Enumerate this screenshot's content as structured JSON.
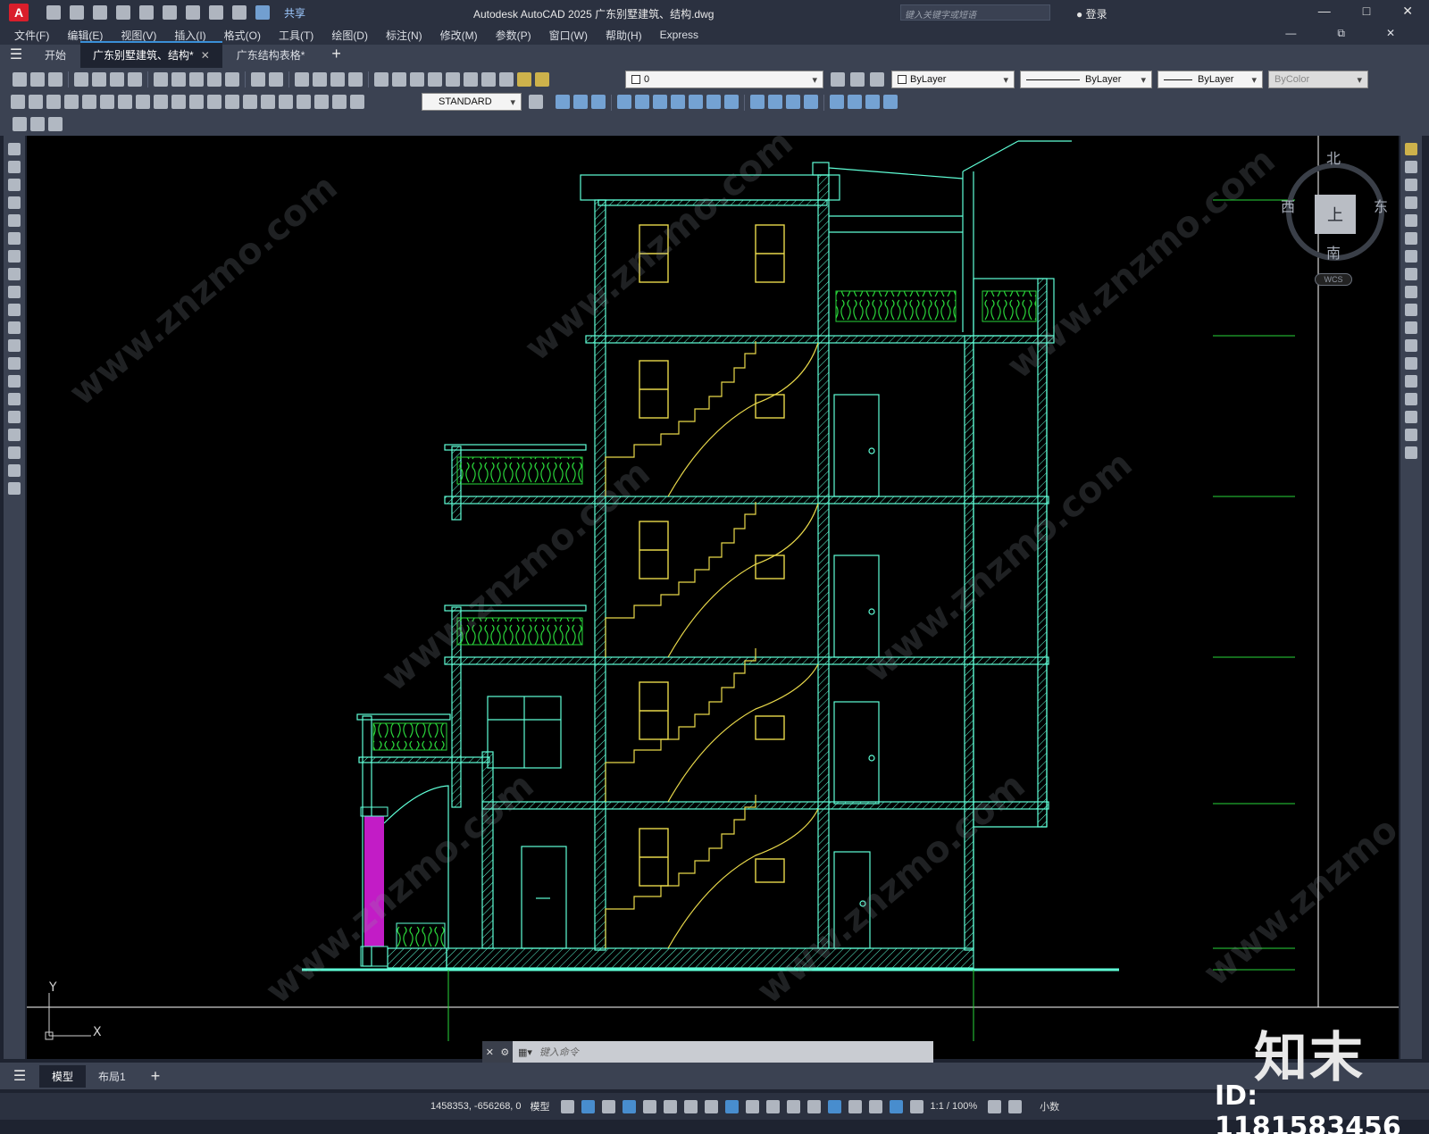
{
  "titlebar": {
    "logo": "A",
    "share": "共享",
    "title": "Autodesk AutoCAD 2025    广东别墅建筑、结构.dwg",
    "search_placeholder": "键入关键字或短语",
    "login": "登录"
  },
  "menu": [
    "文件(F)",
    "编辑(E)",
    "视图(V)",
    "插入(I)",
    "格式(O)",
    "工具(T)",
    "绘图(D)",
    "标注(N)",
    "修改(M)",
    "参数(P)",
    "窗口(W)",
    "帮助(H)",
    "Express"
  ],
  "tabs": [
    {
      "label": "开始",
      "active": false
    },
    {
      "label": "广东别墅建筑、结构*",
      "active": true
    },
    {
      "label": "广东结构表格*",
      "active": false
    }
  ],
  "properties": {
    "layer": "0",
    "color": "ByLayer",
    "linetype": "ByLayer",
    "lineweight": "ByLayer",
    "plotstyle": "ByColor",
    "textstyle": "STANDARD"
  },
  "viewcube": {
    "north": "北",
    "south": "南",
    "east": "东",
    "west": "西",
    "face": "上",
    "wcs": "WCS"
  },
  "ucs": {
    "x": "X",
    "y": "Y"
  },
  "command": {
    "placeholder": "键入命令"
  },
  "layout_tabs": [
    {
      "label": "模型",
      "active": true
    },
    {
      "label": "布局1",
      "active": false
    }
  ],
  "status": {
    "coords": "1458353, -656268, 0",
    "space": "模型",
    "scale": "1:1 / 100%",
    "units": "小数"
  },
  "brand": {
    "logo_text": "知末",
    "id": "ID: 1181583456"
  },
  "colors": {
    "canvas": "#000000",
    "cyan": "#5fffd7",
    "yellow": "#e8d84a",
    "green": "#29d63a",
    "magenta": "#c21cc6"
  }
}
